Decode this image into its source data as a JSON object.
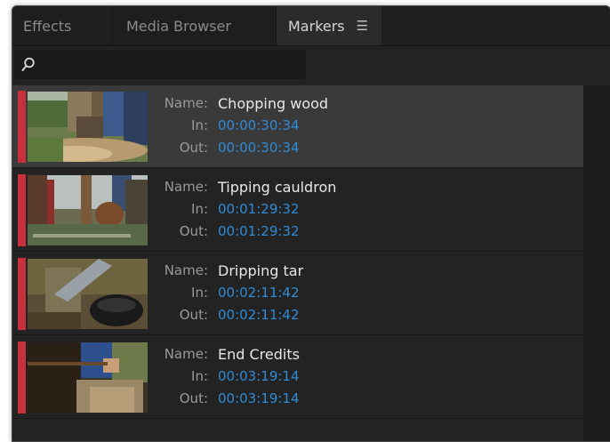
{
  "tabs": [
    {
      "label": "Effects"
    },
    {
      "label": "Media Browser"
    },
    {
      "label": "Markers",
      "active": true
    }
  ],
  "search": {
    "placeholder": "",
    "icon": "search-icon"
  },
  "labels": {
    "name": "Name:",
    "in": "In:",
    "out": "Out:"
  },
  "colors": {
    "marker": "#c8303d",
    "timecode": "#2f8bd6",
    "selected_row": "#3a3a3a"
  },
  "markers": [
    {
      "name": "Chopping wood",
      "in": "00:00:30:34",
      "out": "00:00:30:34",
      "selected": true
    },
    {
      "name": "Tipping cauldron",
      "in": "00:01:29:32",
      "out": "00:01:29:32"
    },
    {
      "name": "Dripping tar",
      "in": "00:02:11:42",
      "out": "00:02:11:42"
    },
    {
      "name": "End Credits",
      "in": "00:03:19:14",
      "out": "00:03:19:14"
    }
  ]
}
